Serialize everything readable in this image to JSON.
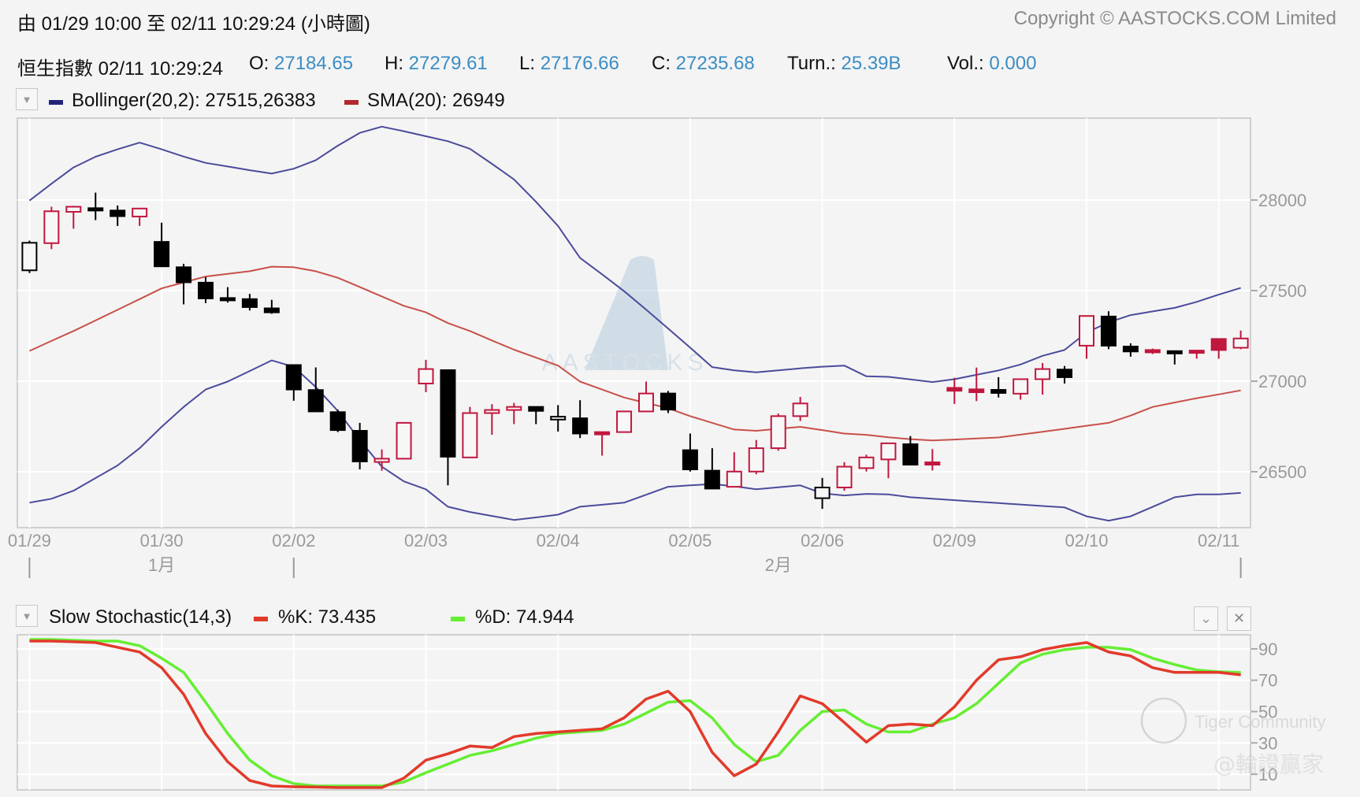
{
  "header": {
    "range_title": "由  01/29 10:00 至  02/11 10:29:24 (小時圖)",
    "copyright": "Copyright © AASTOCKS.COM Limited"
  },
  "quote": {
    "name_time": "恒生指數 02/11 10:29:24",
    "open_label": "O:",
    "open": "27184.65",
    "high_label": "H:",
    "high": "27279.61",
    "low_label": "L:",
    "low": "27176.66",
    "close_label": "C:",
    "close": "27235.68",
    "turnover_label": "Turn.:",
    "turnover": "25.39B",
    "volume_label": "Vol.:",
    "volume": "0.000"
  },
  "main_legend": {
    "bollinger": "Bollinger(20,2): 27515,26383",
    "sma": "SMA(20): 26949"
  },
  "stoch_legend": {
    "title": "Slow Stochastic(14,3)",
    "k": "%K: 73.435",
    "d": "%D: 74.944"
  },
  "watermarks": {
    "aastocks": "AASTOCKS",
    "tiger": "Tiger Community",
    "author": "@輪證贏家"
  },
  "colors": {
    "bollinger": "#4b4b9c",
    "sma": "#c8504a",
    "candle_red": "#c0173e",
    "candle_black": "#000000",
    "k_line": "#e23a2a",
    "d_line": "#66ee33",
    "value_text": "#3b8dc4"
  },
  "chart_data": [
    {
      "type": "candlestick",
      "y_ticks": [
        "28000",
        "27500",
        "27000",
        "26500"
      ],
      "ylim": [
        26191,
        28452
      ],
      "grid": true,
      "x_tick_labels": [
        "01/29",
        "01/30",
        "02/02",
        "02/03",
        "02/04",
        "02/05",
        "02/06",
        "02/09",
        "02/10",
        "02/11"
      ],
      "month_labels": [
        "1月",
        "2月"
      ],
      "candles": [
        {
          "o": 27612,
          "h": 27776,
          "l": 27597,
          "c": 27764,
          "color": "black",
          "filled": false
        },
        {
          "o": 27762,
          "h": 27963,
          "l": 27729,
          "c": 27938,
          "color": "red",
          "filled": false
        },
        {
          "o": 27935,
          "h": 27968,
          "l": 27842,
          "c": 27963,
          "color": "red",
          "filled": false
        },
        {
          "o": 27955,
          "h": 28041,
          "l": 27889,
          "c": 27950,
          "color": "black",
          "filled": true
        },
        {
          "o": 27942,
          "h": 27970,
          "l": 27857,
          "c": 27911,
          "color": "black",
          "filled": true
        },
        {
          "o": 27909,
          "h": 27955,
          "l": 27857,
          "c": 27953,
          "color": "red",
          "filled": false
        },
        {
          "o": 27769,
          "h": 27875,
          "l": 27630,
          "c": 27634,
          "color": "black",
          "filled": true
        },
        {
          "o": 27629,
          "h": 27648,
          "l": 27424,
          "c": 27546,
          "color": "black",
          "filled": true
        },
        {
          "o": 27544,
          "h": 27574,
          "l": 27431,
          "c": 27457,
          "color": "black",
          "filled": true
        },
        {
          "o": 27459,
          "h": 27519,
          "l": 27434,
          "c": 27455,
          "color": "black",
          "filled": true
        },
        {
          "o": 27453,
          "h": 27482,
          "l": 27390,
          "c": 27409,
          "color": "black",
          "filled": true
        },
        {
          "o": 27402,
          "h": 27449,
          "l": 27372,
          "c": 27380,
          "color": "black",
          "filled": true
        },
        {
          "o": 27089,
          "h": 27089,
          "l": 26892,
          "c": 26954,
          "color": "black",
          "filled": true
        },
        {
          "o": 26951,
          "h": 27076,
          "l": 26833,
          "c": 26833,
          "color": "black",
          "filled": true
        },
        {
          "o": 26829,
          "h": 26843,
          "l": 26719,
          "c": 26730,
          "color": "black",
          "filled": true
        },
        {
          "o": 26726,
          "h": 26770,
          "l": 26513,
          "c": 26557,
          "color": "black",
          "filled": true
        },
        {
          "o": 26554,
          "h": 26623,
          "l": 26506,
          "c": 26572,
          "color": "red",
          "filled": false
        },
        {
          "o": 26572,
          "h": 26770,
          "l": 26572,
          "c": 26770,
          "color": "red",
          "filled": false
        },
        {
          "o": 26987,
          "h": 27118,
          "l": 26939,
          "c": 27067,
          "color": "red",
          "filled": false
        },
        {
          "o": 27061,
          "h": 27061,
          "l": 26425,
          "c": 26583,
          "color": "black",
          "filled": true
        },
        {
          "o": 26579,
          "h": 26858,
          "l": 26579,
          "c": 26824,
          "color": "red",
          "filled": false
        },
        {
          "o": 26824,
          "h": 26873,
          "l": 26704,
          "c": 26841,
          "color": "red",
          "filled": false
        },
        {
          "o": 26841,
          "h": 26880,
          "l": 26763,
          "c": 26858,
          "color": "red",
          "filled": false
        },
        {
          "o": 26858,
          "h": 26860,
          "l": 26763,
          "c": 26836,
          "color": "black",
          "filled": true
        },
        {
          "o": 26788,
          "h": 26868,
          "l": 26722,
          "c": 26804,
          "color": "black",
          "filled": false
        },
        {
          "o": 26795,
          "h": 26895,
          "l": 26686,
          "c": 26711,
          "color": "black",
          "filled": true
        },
        {
          "o": 26719,
          "h": 26719,
          "l": 26589,
          "c": 26709,
          "color": "red",
          "filled": true
        },
        {
          "o": 26719,
          "h": 26833,
          "l": 26719,
          "c": 26833,
          "color": "red",
          "filled": false
        },
        {
          "o": 26833,
          "h": 26998,
          "l": 26833,
          "c": 26932,
          "color": "red",
          "filled": false
        },
        {
          "o": 26932,
          "h": 26946,
          "l": 26824,
          "c": 26843,
          "color": "black",
          "filled": true
        },
        {
          "o": 26619,
          "h": 26711,
          "l": 26501,
          "c": 26513,
          "color": "black",
          "filled": true
        },
        {
          "o": 26506,
          "h": 26630,
          "l": 26407,
          "c": 26407,
          "color": "black",
          "filled": true
        },
        {
          "o": 26417,
          "h": 26608,
          "l": 26417,
          "c": 26501,
          "color": "red",
          "filled": false
        },
        {
          "o": 26501,
          "h": 26675,
          "l": 26486,
          "c": 26630,
          "color": "red",
          "filled": false
        },
        {
          "o": 26630,
          "h": 26821,
          "l": 26616,
          "c": 26807,
          "color": "red",
          "filled": false
        },
        {
          "o": 26807,
          "h": 26913,
          "l": 26780,
          "c": 26877,
          "color": "red",
          "filled": false
        },
        {
          "o": 26354,
          "h": 26466,
          "l": 26295,
          "c": 26413,
          "color": "black",
          "filled": false
        },
        {
          "o": 26413,
          "h": 26553,
          "l": 26395,
          "c": 26528,
          "color": "red",
          "filled": false
        },
        {
          "o": 26520,
          "h": 26594,
          "l": 26501,
          "c": 26579,
          "color": "red",
          "filled": false
        },
        {
          "o": 26568,
          "h": 26657,
          "l": 26464,
          "c": 26657,
          "color": "red",
          "filled": false
        },
        {
          "o": 26652,
          "h": 26697,
          "l": 26539,
          "c": 26539,
          "color": "black",
          "filled": true
        },
        {
          "o": 26552,
          "h": 26625,
          "l": 26507,
          "c": 26541,
          "color": "red",
          "filled": true
        },
        {
          "o": 26963,
          "h": 27019,
          "l": 26874,
          "c": 26947,
          "color": "red",
          "filled": true
        },
        {
          "o": 26955,
          "h": 27075,
          "l": 26890,
          "c": 26939,
          "color": "red",
          "filled": true
        },
        {
          "o": 26952,
          "h": 27022,
          "l": 26910,
          "c": 26935,
          "color": "black",
          "filled": true
        },
        {
          "o": 26931,
          "h": 27011,
          "l": 26898,
          "c": 27011,
          "color": "red",
          "filled": false
        },
        {
          "o": 27011,
          "h": 27100,
          "l": 26926,
          "c": 27067,
          "color": "red",
          "filled": false
        },
        {
          "o": 27064,
          "h": 27084,
          "l": 26987,
          "c": 27022,
          "color": "black",
          "filled": true
        },
        {
          "o": 27196,
          "h": 27360,
          "l": 27124,
          "c": 27360,
          "color": "red",
          "filled": false
        },
        {
          "o": 27357,
          "h": 27386,
          "l": 27177,
          "c": 27196,
          "color": "black",
          "filled": true
        },
        {
          "o": 27191,
          "h": 27209,
          "l": 27135,
          "c": 27164,
          "color": "black",
          "filled": true
        },
        {
          "o": 27172,
          "h": 27180,
          "l": 27150,
          "c": 27161,
          "color": "red",
          "filled": true
        },
        {
          "o": 27166,
          "h": 27168,
          "l": 27092,
          "c": 27162,
          "color": "black",
          "filled": true
        },
        {
          "o": 27169,
          "h": 27169,
          "l": 27124,
          "c": 27161,
          "color": "red",
          "filled": true
        },
        {
          "o": 27233,
          "h": 27233,
          "l": 27124,
          "c": 27172,
          "color": "red",
          "filled": true
        },
        {
          "o": 27184.65,
          "h": 27279.61,
          "l": 27176.66,
          "c": 27235.68,
          "color": "red",
          "filled": false
        }
      ],
      "bollinger_upper": [
        27997,
        28090,
        28180,
        28239,
        28280,
        28317,
        28280,
        28240,
        28205,
        28185,
        28165,
        28146,
        28173,
        28220,
        28300,
        28371,
        28405,
        28380,
        28352,
        28325,
        28283,
        28200,
        28114,
        27990,
        27857,
        27681,
        27590,
        27497,
        27395,
        27291,
        27185,
        27078,
        27060,
        27049,
        27060,
        27071,
        27080,
        27086,
        27027,
        27024,
        27010,
        26995,
        27011,
        27035,
        27059,
        27092,
        27140,
        27172,
        27269,
        27325,
        27365,
        27385,
        27405,
        27438,
        27478,
        27515
      ],
      "bollinger_lower": [
        26329,
        26351,
        26395,
        26465,
        26535,
        26630,
        26748,
        26858,
        26954,
        26998,
        27056,
        27115,
        27079,
        26968,
        26836,
        26675,
        26528,
        26447,
        26403,
        26307,
        26278,
        26256,
        26234,
        26248,
        26263,
        26307,
        26318,
        26329,
        26373,
        26417,
        26425,
        26432,
        26420,
        26403,
        26414,
        26425,
        26381,
        26369,
        26378,
        26375,
        26359,
        26351,
        26343,
        26335,
        26327,
        26319,
        26311,
        26303,
        26254,
        26230,
        26254,
        26306,
        26359,
        26375,
        26375,
        26383
      ],
      "sma20": [
        27167,
        27222,
        27277,
        27335,
        27394,
        27453,
        27512,
        27545,
        27578,
        27592,
        27607,
        27632,
        27629,
        27607,
        27571,
        27520,
        27468,
        27416,
        27380,
        27321,
        27277,
        27225,
        27174,
        27130,
        27086,
        26998,
        26954,
        26910,
        26880,
        26851,
        26807,
        26770,
        26733,
        26726,
        26737,
        26748,
        26730,
        26711,
        26704,
        26690,
        26680,
        26673,
        26678,
        26684,
        26689,
        26705,
        26721,
        26737,
        26754,
        26770,
        26810,
        26858,
        26882,
        26906,
        26927,
        26949
      ]
    },
    {
      "type": "line",
      "y_ticks": [
        "90",
        "70",
        "50",
        "30",
        "10"
      ],
      "ylim": [
        0,
        99
      ],
      "grid": true,
      "series": [
        {
          "name": "%K",
          "values": [
            95,
            95,
            94.5,
            94,
            91,
            88,
            78,
            61,
            36,
            18,
            6,
            2.5,
            2,
            1.8,
            1.5,
            1.5,
            1.5,
            7.5,
            19,
            23,
            28,
            27,
            34,
            36,
            37,
            38,
            39,
            46,
            58,
            63,
            50,
            24,
            9,
            16.5,
            37,
            60,
            55,
            43,
            30.5,
            41,
            42,
            41,
            53,
            70,
            83,
            85,
            89.5,
            92,
            94,
            88,
            85.5,
            78,
            75,
            75,
            75,
            73.435
          ]
        },
        {
          "name": "%D",
          "values": [
            96,
            96,
            95.5,
            95,
            95,
            92,
            84,
            75,
            56,
            36,
            19,
            9,
            4,
            2.5,
            2.5,
            2.5,
            2.5,
            5,
            11,
            16.5,
            22,
            25,
            29,
            33,
            36,
            37,
            38,
            42,
            49,
            56,
            57,
            46,
            29,
            18,
            22,
            38,
            50,
            51,
            42,
            37,
            37,
            42,
            46,
            55,
            68,
            81,
            86.6,
            89.5,
            91,
            91,
            89.5,
            84,
            80,
            76.5,
            75.4,
            74.944
          ]
        }
      ]
    }
  ]
}
